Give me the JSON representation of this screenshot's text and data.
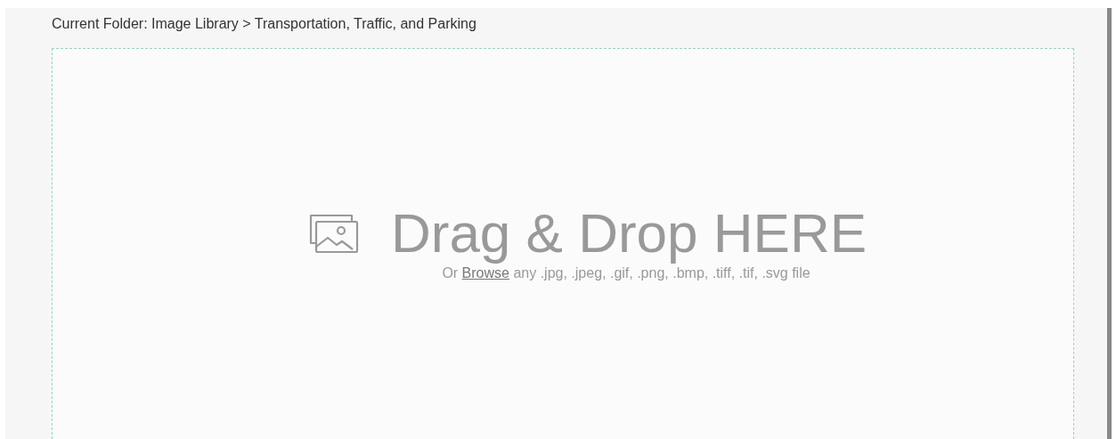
{
  "breadcrumb": "Current Folder: Image Library > Transportation, Traffic, and Parking",
  "dropzone": {
    "title": "Drag & Drop HERE",
    "hint": {
      "before": "Or",
      "link": "Browse",
      "after": "any .jpg, .jpeg, .gif, .png, .bmp, .tiff, .tif, .svg file"
    }
  }
}
